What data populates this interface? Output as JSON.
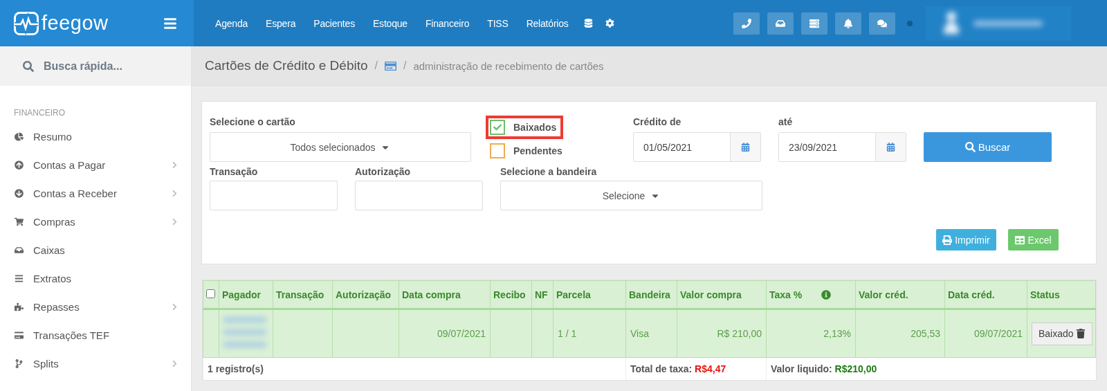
{
  "app": {
    "logo": "feegow"
  },
  "nav": {
    "items": [
      "Agenda",
      "Espera",
      "Pacientes",
      "Estoque",
      "Financeiro",
      "TISS",
      "Relatórios"
    ]
  },
  "user": {
    "online": true
  },
  "sidebar": {
    "search_placeholder": "Busca rápida...",
    "section": "FINANCEIRO",
    "items": [
      {
        "label": "Resumo",
        "expandable": false
      },
      {
        "label": "Contas a Pagar",
        "expandable": true
      },
      {
        "label": "Contas a Receber",
        "expandable": true
      },
      {
        "label": "Compras",
        "expandable": true
      },
      {
        "label": "Caixas",
        "expandable": false
      },
      {
        "label": "Extratos",
        "expandable": false
      },
      {
        "label": "Repasses",
        "expandable": true
      },
      {
        "label": "Transações TEF",
        "expandable": false
      },
      {
        "label": "Splits",
        "expandable": true
      }
    ]
  },
  "breadcrumb": {
    "title": "Cartões de Crédito e Débito",
    "separators": [
      "/",
      "/"
    ],
    "current": "administração de recebimento de cartões"
  },
  "filters": {
    "card_select": {
      "label": "Selecione o cartão",
      "value": "Todos selecionados"
    },
    "status_checks": [
      {
        "label": "Baixados",
        "checked": true,
        "highlighted": true,
        "color": "#6cc070"
      },
      {
        "label": "Pendentes",
        "checked": false,
        "highlighted": false,
        "color": "#f0ad4e"
      }
    ],
    "credit_from": {
      "label": "Crédito de",
      "value": "01/05/2021"
    },
    "credit_to": {
      "label": "até",
      "value": "23/09/2021"
    },
    "search_button": "Buscar",
    "transaction": {
      "label": "Transação"
    },
    "authorization": {
      "label": "Autorização"
    },
    "brand_select": {
      "label": "Selecione a bandeira",
      "value": "Selecione"
    },
    "print_button": "Imprimir",
    "excel_button": "Excel"
  },
  "table": {
    "columns": [
      {
        "kind": "checkbox",
        "checked": false
      },
      {
        "kind": "text",
        "label": "Pagador"
      },
      {
        "kind": "text",
        "label": "Transação"
      },
      {
        "kind": "text",
        "label": "Autorização"
      },
      {
        "kind": "text",
        "label": "Data compra"
      },
      {
        "kind": "text",
        "label": "Recibo"
      },
      {
        "kind": "text",
        "label": "NF"
      },
      {
        "kind": "text",
        "label": "Parcela"
      },
      {
        "kind": "text",
        "label": "Bandeira"
      },
      {
        "kind": "text",
        "label": "Valor compra"
      },
      {
        "kind": "info",
        "label": "Taxa %"
      },
      {
        "kind": "text",
        "label": "Valor créd."
      },
      {
        "kind": "text",
        "label": "Data créd."
      },
      {
        "kind": "status",
        "label": "Status"
      }
    ],
    "rows": [
      {
        "payer_redacted": true,
        "cells": [
          "",
          "",
          "",
          "",
          "09/07/2021",
          "",
          "",
          "1 / 1",
          "Visa",
          "R$ 210,00",
          "2,13%",
          "205,53",
          "09/07/2021",
          "Baixado"
        ]
      }
    ],
    "footer": {
      "count": "1 registro(s)",
      "fee_label": "Total de taxa:",
      "fee_value": "R$4,47",
      "net_label": "Valor liquido:",
      "net_value": "R$210,00"
    }
  }
}
